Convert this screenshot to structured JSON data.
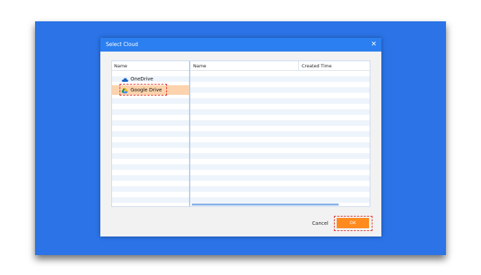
{
  "dialog": {
    "title": "Select Cloud",
    "close_symbol": "✕",
    "accent_color": "#2b7ff0"
  },
  "left_pane": {
    "header": "Name",
    "items": [
      {
        "label": "OneDrive",
        "icon": "onedrive-cloud-icon",
        "selected": false
      },
      {
        "label": "Google Drive",
        "icon": "google-drive-icon",
        "selected": true
      }
    ]
  },
  "right_pane": {
    "columns": [
      "Name",
      "Created Time"
    ],
    "rows": []
  },
  "buttons": {
    "cancel": "Cancel",
    "ok": "OK",
    "ok_color": "#ff8a1e"
  },
  "highlight_color": "#e0241b"
}
